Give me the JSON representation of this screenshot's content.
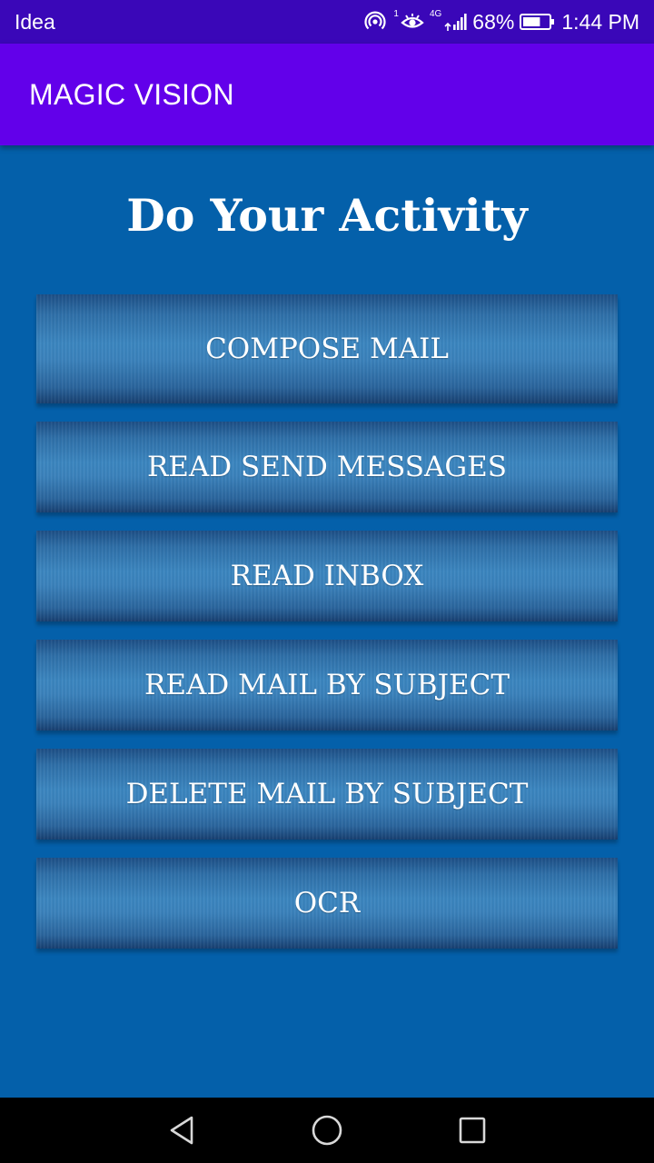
{
  "status_bar": {
    "carrier": "Idea",
    "hotspot_count": "1",
    "network_type": "4G",
    "battery_percent": "68%",
    "battery_level": 0.68,
    "time": "1:44 PM"
  },
  "app_bar": {
    "title": "MAGIC VISION"
  },
  "main": {
    "heading": "Do Your Activity",
    "buttons": [
      "COMPOSE MAIL",
      "READ SEND MESSAGES",
      "READ INBOX",
      "READ MAIL BY SUBJECT",
      "DELETE MAIL BY SUBJECT",
      "OCR"
    ]
  },
  "nav_bar": {
    "icons": [
      "back-icon",
      "home-icon",
      "recents-icon"
    ]
  },
  "colors": {
    "status_bar": "#3a07b8",
    "app_bar": "#6200ea",
    "background": "#0460aa"
  }
}
